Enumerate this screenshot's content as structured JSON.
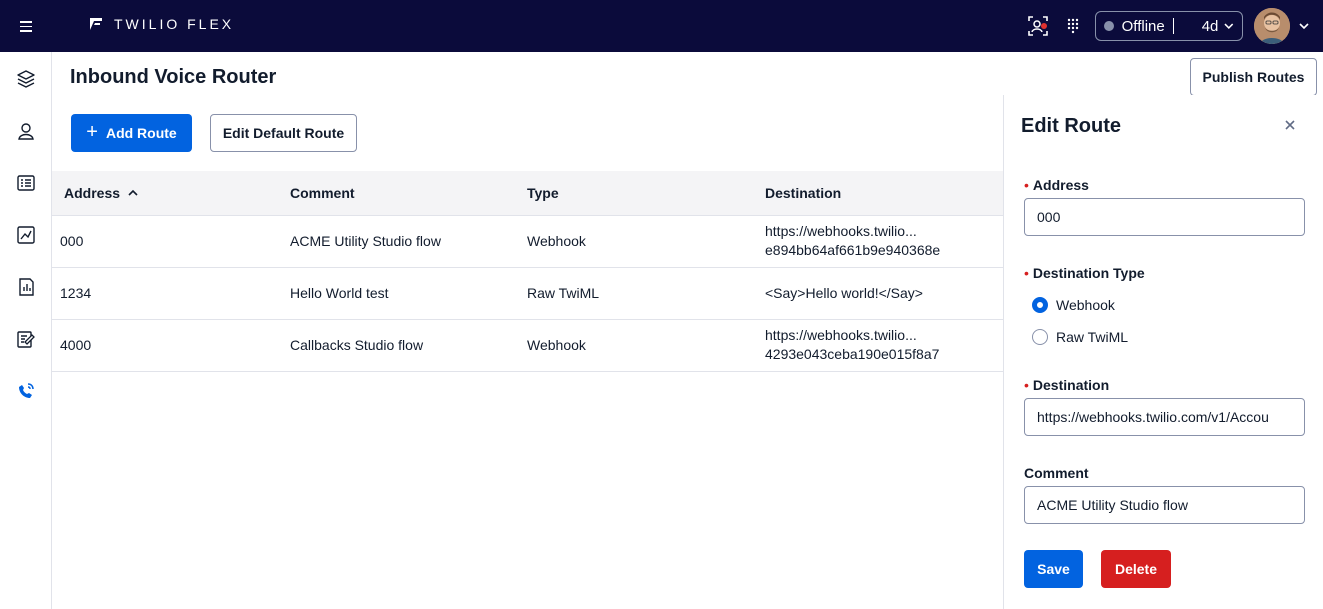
{
  "header": {
    "brand": "TWILIO FLEX",
    "status": {
      "label": "Offline",
      "duration": "4d",
      "dot_color": "#8891aa"
    },
    "bg_color": "#0b0b3b"
  },
  "rail": {
    "items": [
      {
        "icon": "layers-icon"
      },
      {
        "icon": "agents-icon"
      },
      {
        "icon": "queues-list-icon"
      },
      {
        "icon": "analytics-icon"
      },
      {
        "icon": "reports-icon"
      },
      {
        "icon": "edit-list-icon"
      },
      {
        "icon": "phone-router-icon",
        "active": true
      }
    ]
  },
  "page": {
    "title": "Inbound Voice Router",
    "publish_label": "Publish Routes",
    "add_label": "Add Route",
    "edit_default_label": "Edit Default Route"
  },
  "table": {
    "columns": [
      "Address",
      "Comment",
      "Type",
      "Destination"
    ],
    "rows": [
      {
        "address": "000",
        "comment": "ACME Utility Studio flow",
        "type": "Webhook",
        "dest_line1": "https://webhooks.twilio...",
        "dest_line2": "e894bb64af661b9e940368e"
      },
      {
        "address": "1234",
        "comment": "Hello World test",
        "type": "Raw TwiML",
        "dest_line1": "<Say>Hello world!</Say>",
        "dest_line2": ""
      },
      {
        "address": "4000",
        "comment": "Callbacks Studio flow",
        "type": "Webhook",
        "dest_line1": "https://webhooks.twilio...",
        "dest_line2": "4293e043ceba190e015f8a7"
      }
    ]
  },
  "panel": {
    "title": "Edit Route",
    "address_label": "Address",
    "address_value": "000",
    "dest_type_label": "Destination Type",
    "dest_type_options": [
      "Webhook",
      "Raw TwiML"
    ],
    "dest_type_selected": "Webhook",
    "destination_label": "Destination",
    "destination_value": "https://webhooks.twilio.com/v1/Accou",
    "comment_label": "Comment",
    "comment_value": "ACME Utility Studio flow",
    "save_label": "Save",
    "delete_label": "Delete"
  },
  "colors": {
    "primary": "#0263e0",
    "destructive": "#d61f1f",
    "border": "#8891aa"
  }
}
